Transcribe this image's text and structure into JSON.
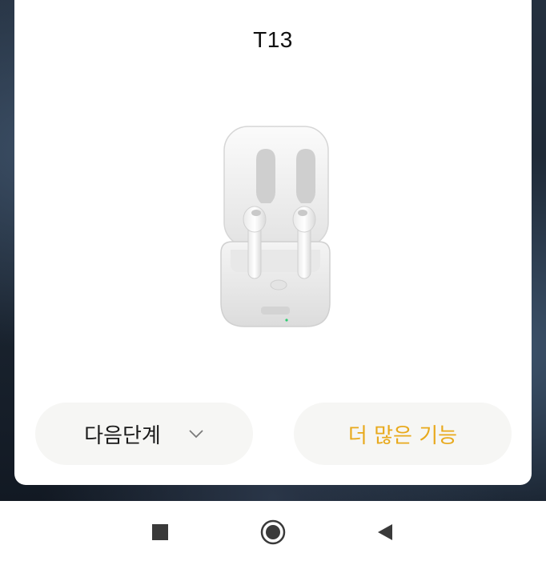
{
  "dialog": {
    "title": "T13",
    "product_image_label": "wireless earbuds in charging case"
  },
  "buttons": {
    "next_step": "다음단계",
    "more_features": "더 많은 기능"
  },
  "colors": {
    "accent": "#e8a91c",
    "pill_bg": "#f6f6f4",
    "sheet_bg": "#ffffff",
    "text": "#111111",
    "wallpaper": "#1b2531"
  },
  "icons": {
    "dropdown": "chevron-down-icon",
    "nav_recents": "square-icon",
    "nav_home": "circle-icon",
    "nav_back": "triangle-left-icon"
  }
}
